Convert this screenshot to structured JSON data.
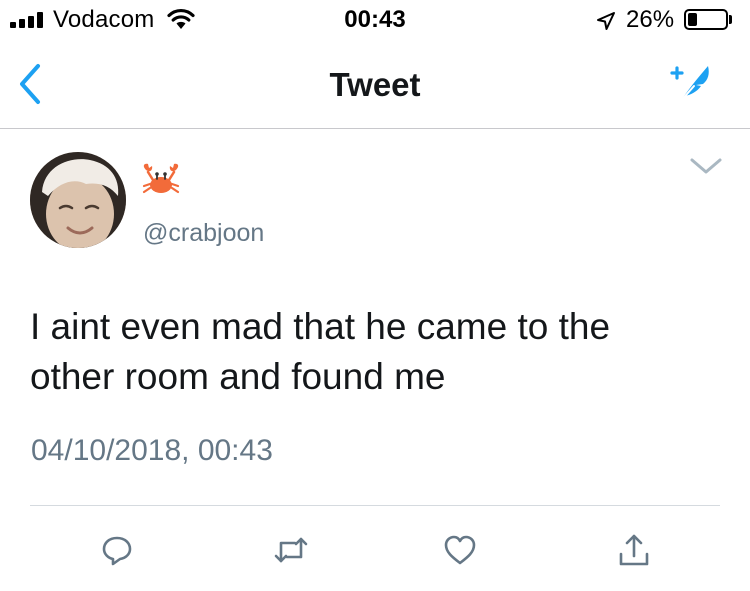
{
  "status_bar": {
    "carrier": "Vodacom",
    "time": "00:43",
    "battery_percent": "26%",
    "battery_level": 0.26,
    "icons": [
      "signal-icon",
      "wifi-icon",
      "location-arrow-icon",
      "battery-icon"
    ]
  },
  "nav": {
    "title": "Tweet",
    "back_icon": "chevron-left-icon",
    "compose_icon": "compose-tweet-icon"
  },
  "tweet": {
    "display_name_emoji": "crab-emoji",
    "handle": "@crabjoon",
    "text": "I aint even mad that he came to the\nother room and found me",
    "timestamp": "04/10/2018, 00:43",
    "menu_icon": "chevron-down-icon"
  },
  "actions": [
    {
      "name": "reply",
      "icon": "reply-icon"
    },
    {
      "name": "retweet",
      "icon": "retweet-icon"
    },
    {
      "name": "like",
      "icon": "heart-icon"
    },
    {
      "name": "share",
      "icon": "share-icon"
    }
  ],
  "colors": {
    "accent": "#1da1f2",
    "primary_text": "#14171a",
    "secondary_text": "#657786",
    "icon_gray": "#657786",
    "divider": "#d5dadf"
  }
}
